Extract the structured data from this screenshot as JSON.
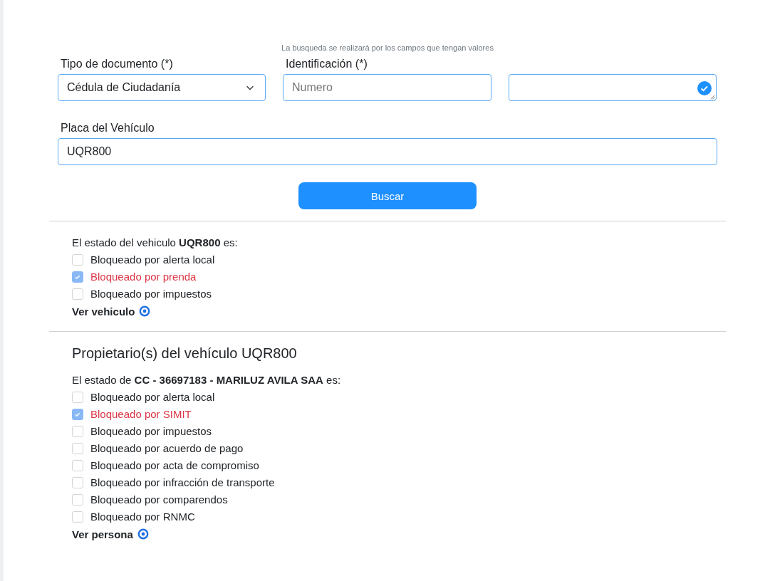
{
  "search_form": {
    "hint": "La busqueda se realizará por los campos que tengan valores",
    "document_type": {
      "label": "Tipo de documento (*)",
      "value": "Cédula de Ciudadanía"
    },
    "identification": {
      "label": "Identificación (*)",
      "placeholder": "Numero"
    },
    "extra_field": {
      "valid": true
    },
    "plate": {
      "label": "Placa del Vehículo",
      "value": "UQR800"
    },
    "button": "Buscar"
  },
  "vehicle_status": {
    "intro": "El estado del vehiculo **UQR800** es:",
    "items": [
      {
        "label": "Bloqueado por alerta local",
        "checked": false
      },
      {
        "label": "Bloqueado por prenda",
        "checked": true
      },
      {
        "label": "Bloqueado por impuestos",
        "checked": false
      }
    ],
    "link": "Ver vehiculo"
  },
  "owners": {
    "title": "Propietario(s) del vehículo UQR800",
    "intro": "El estado de **CC - 36697183 - MARILUZ AVILA SAA** es:",
    "items": [
      {
        "label": "Bloqueado por alerta local",
        "checked": false
      },
      {
        "label": "Bloqueado por SIMIT",
        "checked": true
      },
      {
        "label": "Bloqueado por impuestos",
        "checked": false
      },
      {
        "label": "Bloqueado por acuerdo de pago",
        "checked": false
      },
      {
        "label": "Bloqueado por acta de compromiso",
        "checked": false
      },
      {
        "label": "Bloqueado por infracción de transporte",
        "checked": false
      },
      {
        "label": "Bloqueado por comparendos",
        "checked": false
      },
      {
        "label": "Bloqueado por RNMC",
        "checked": false
      }
    ],
    "link": "Ver persona"
  }
}
